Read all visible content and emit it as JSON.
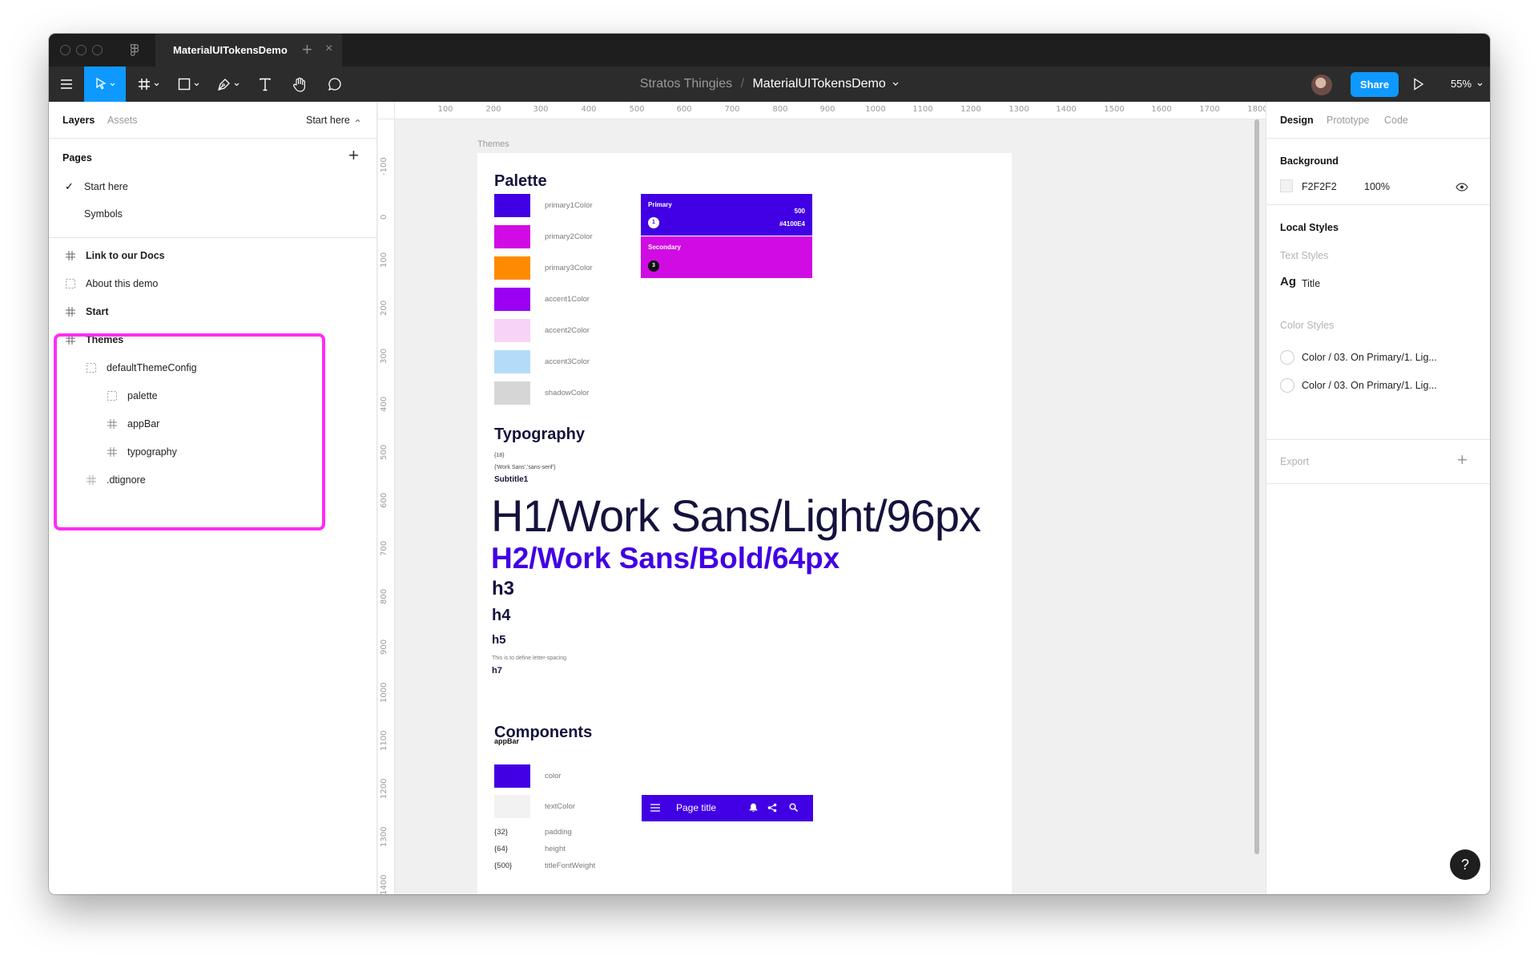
{
  "tab": {
    "title": "MaterialUITokensDemo",
    "close": "×",
    "new_tab": "+"
  },
  "toolbar": {
    "breadcrumb_project": "Stratos Thingies",
    "breadcrumb_sep": "/",
    "breadcrumb_file": "MaterialUITokensDemo",
    "share_label": "Share",
    "zoom": "55%"
  },
  "left_panel": {
    "tabs": [
      "Layers",
      "Assets"
    ],
    "current_page": "Start here",
    "pages_header": "Pages",
    "pages": [
      "Start here",
      "Symbols"
    ],
    "layers": [
      {
        "label": "Link to our Docs",
        "icon": "frame-icon",
        "bold": true
      },
      {
        "label": "About this demo",
        "icon": "group-icon",
        "bold": false
      },
      {
        "label": "Start",
        "icon": "frame-icon",
        "bold": true
      },
      {
        "label": "Themes",
        "icon": "frame-icon",
        "bold": true
      },
      {
        "label": "defaultThemeConfig",
        "icon": "group-icon",
        "bold": false
      },
      {
        "label": "palette",
        "icon": "group-icon",
        "bold": false
      },
      {
        "label": "appBar",
        "icon": "frame-icon",
        "bold": false
      },
      {
        "label": "typography",
        "icon": "frame-icon",
        "bold": false
      },
      {
        "label": ".dtignore",
        "icon": "frame-icon",
        "bold": false
      }
    ],
    "highlight_color": "#ff2cf5"
  },
  "rulers": {
    "top": [
      "100",
      "200",
      "300",
      "400",
      "500",
      "600",
      "700",
      "800",
      "900",
      "1000",
      "1100",
      "1200",
      "1300",
      "1400",
      "1500",
      "1600",
      "1700",
      "1800"
    ],
    "left": [
      "-100",
      "0",
      "100",
      "200",
      "300",
      "400",
      "500",
      "600",
      "700",
      "800",
      "900",
      "1000",
      "1100",
      "1200",
      "1300",
      "1400"
    ]
  },
  "canvas": {
    "frame_label": "Themes",
    "palette": {
      "title": "Palette",
      "swatches": [
        {
          "label": "primary1Color",
          "color": "#4100e4"
        },
        {
          "label": "primary2Color",
          "color": "#d10be4"
        },
        {
          "label": "primary3Color",
          "color": "#ff8a00"
        },
        {
          "label": "accent1Color",
          "color": "#9b00f2"
        },
        {
          "label": "accent2Color",
          "color": "#f8d3f8"
        },
        {
          "label": "accent3Color",
          "color": "#b3dcf9"
        },
        {
          "label": "shadowColor",
          "color": "#d6d6d6"
        }
      ],
      "card": {
        "primary_label": "Primary",
        "primary_weight": "500",
        "primary_hex": "#4100E4",
        "primary_index": "1",
        "secondary_label": "Secondary",
        "secondary_index": "3"
      }
    },
    "typography": {
      "title": "Typography",
      "token_size": "{18}",
      "token_font": "{'Work Sans','sans-serif'}",
      "subtitle1": "Subtitle1",
      "h1": "H1/Work Sans/Light/96px",
      "h2": "H2/Work Sans/Bold/64px",
      "h3": "h3",
      "h4": "h4",
      "h5": "h5",
      "letter_spacing_note": "This is to define letter-spacing",
      "h7": "h7"
    },
    "components": {
      "title": "Components",
      "appbar_label": "appBar",
      "color_label": "color",
      "color_value": "#4100e4",
      "text_color_label": "textColor",
      "text_color_value": "#f2f2f2",
      "tokens": [
        {
          "value": "{32}",
          "key": "padding"
        },
        {
          "value": "{64}",
          "key": "height"
        },
        {
          "value": "{500}",
          "key": "titleFontWeight"
        }
      ],
      "appbar_demo_title": "Page title"
    }
  },
  "right_panel": {
    "tabs": [
      "Design",
      "Prototype",
      "Code"
    ],
    "background_header": "Background",
    "background_hex": "F2F2F2",
    "background_opacity": "100%",
    "local_styles_header": "Local Styles",
    "text_styles_header": "Text Styles",
    "text_style_glyph": "Ag",
    "text_style_name": "Title",
    "color_styles_header": "Color Styles",
    "color_styles": [
      "Color / 03. On Primary/1. Lig...",
      "Color / 03. On Primary/1. Lig..."
    ],
    "export_header": "Export"
  },
  "help": "?"
}
